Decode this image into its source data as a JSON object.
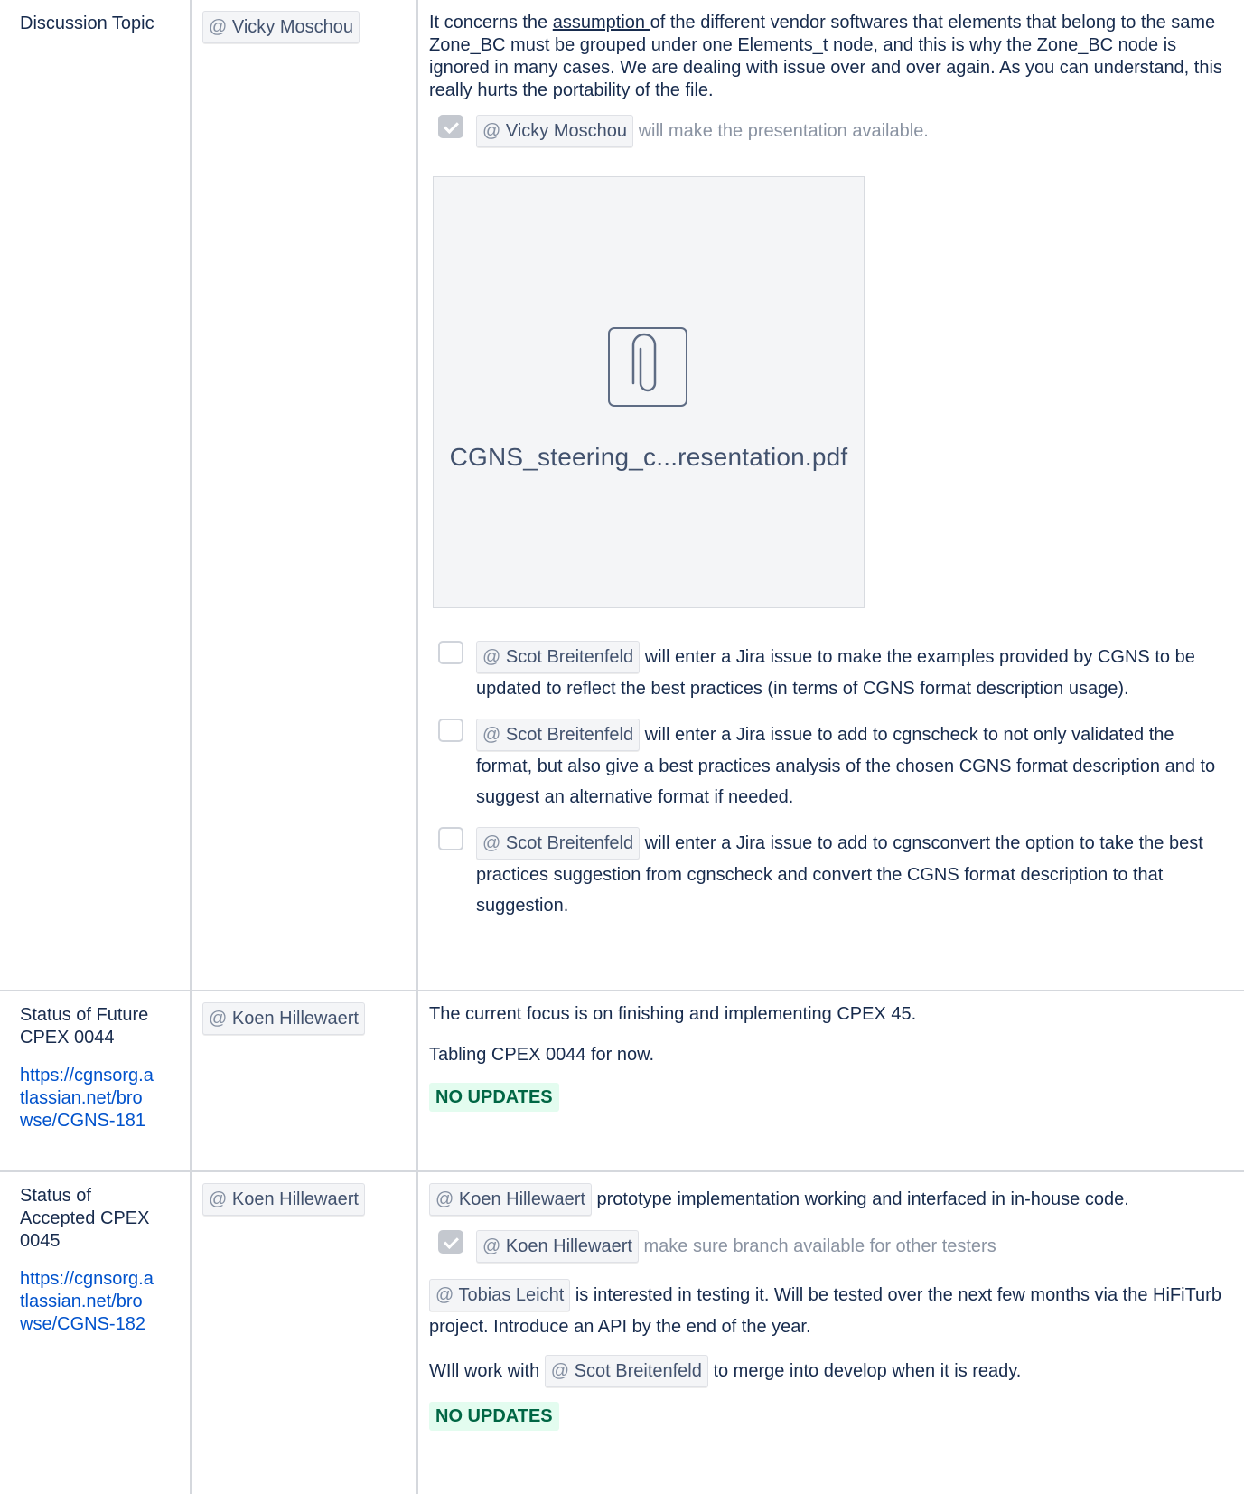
{
  "rows": [
    {
      "topic": "Discussion Topic",
      "topic_link": "",
      "owner": "Vicky Moschou",
      "paragraphs": [
        {
          "pre": "It concerns the ",
          "underline": "assumption ",
          "post": "of the different vendor softwares that elements that belong to the same Zone_BC must be grouped under one Elements_t node, and this is why the Zone_BC node is ignored in many cases. We are dealing with issue over and over again. As you can understand, this really hurts the portability of the file."
        }
      ],
      "tasks": [
        {
          "checked": true,
          "mention": "Vicky Moschou",
          "text": "will make the presentation available."
        },
        {
          "checked": false,
          "mention": "Scot Breitenfeld",
          "text": "will enter a Jira issue to make the examples provided by CGNS to be updated to reflect the best practices (in terms of CGNS format description usage)."
        },
        {
          "checked": false,
          "mention": "Scot Breitenfeld",
          "text": "will enter a Jira issue to add to cgnscheck to not only validated the format, but also give a best practices analysis of the chosen CGNS format description and to suggest an alternative format if needed."
        },
        {
          "checked": false,
          "mention": "Scot Breitenfeld",
          "text": "will enter a Jira issue to add to cgnsconvert the option to take the best practices suggestion from cgnscheck and convert the CGNS format description to that suggestion."
        }
      ],
      "attachment": {
        "filename": "CGNS_steering_c...resentation.pdf",
        "icon": "paperclip-icon"
      }
    },
    {
      "topic": "Status of Future CPEX 0044",
      "topic_link": "https://cgnsorg.atlassian.net/browse/CGNS-181",
      "owner": "Koen Hillewaert",
      "para1": "The current focus is on finishing and implementing CPEX 45.",
      "para2": "Tabling CPEX 0044 for now.",
      "status": "NO UPDATES"
    },
    {
      "topic": "Status of Accepted CPEX 0045",
      "topic_link": "https://cgnsorg.atlassian.net/browse/CGNS-182",
      "owner": "Koen Hillewaert",
      "line1_mention": "Koen Hillewaert",
      "line1_text": "prototype implementation working and interfaced in in-house code.",
      "task": {
        "checked": true,
        "mention": "Koen Hillewaert",
        "text": "make sure branch available for other testers"
      },
      "line2_mention": "Tobias Leicht",
      "line2_text": "is interested in testing it. Will be tested over the next few months via the HiFiTurb project. Introduce an API by the end of the year.",
      "line3_pre": "WIll work with",
      "line3_mention": "Scot Breitenfeld",
      "line3_post": "to merge into develop when it is ready.",
      "status": "NO UPDATES"
    }
  ],
  "mention_prefix": "@",
  "colors": {
    "link": "#0052cc",
    "status_bg": "#e3fcef",
    "status_fg": "#006644",
    "border": "#d5d8dd"
  }
}
